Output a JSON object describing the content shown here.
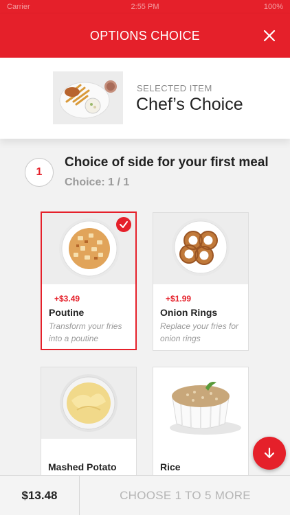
{
  "status_bar": {
    "left": "Carrier",
    "time": "2:55 PM",
    "right": "100%"
  },
  "header": {
    "title": "OPTIONS CHOICE"
  },
  "selected_item": {
    "label": "SELECTED ITEM",
    "name": "Chef’s Choice"
  },
  "step": {
    "number": "1",
    "title": "Choice of side for your first meal",
    "choice_count": "Choice: 1 / 1"
  },
  "options": [
    {
      "price": "+$3.49",
      "name": "Poutine",
      "description": "Transform your fries into a poutine",
      "selected": true,
      "image": "poutine-image"
    },
    {
      "price": "+$1.99",
      "name": "Onion Rings",
      "description": "Replace your fries for onion rings",
      "selected": false,
      "image": "onion-rings-image"
    },
    {
      "price": "",
      "name": "Mashed Potato",
      "description": "",
      "selected": false,
      "image": "mashed-potato-image"
    },
    {
      "price": "",
      "name": "Rice",
      "description": "",
      "selected": false,
      "image": "rice-image"
    }
  ],
  "footer": {
    "total": "$13.48",
    "action_label": "CHOOSE 1 TO 5 MORE"
  },
  "colors": {
    "accent": "#e5202a",
    "muted_text": "#9a9a9a",
    "background": "#f2f2f2"
  },
  "icons": {
    "close": "close-icon",
    "check": "checkmark-icon",
    "scroll_down": "arrow-down-icon"
  }
}
